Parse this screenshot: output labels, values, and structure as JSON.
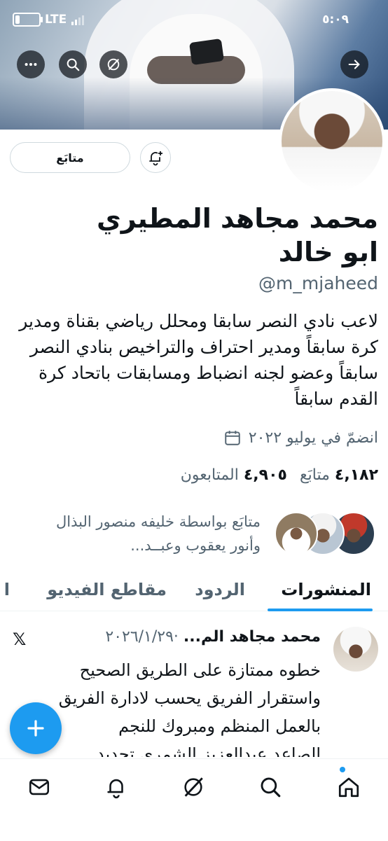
{
  "status_bar": {
    "network": "LTE",
    "time": "٥:٠٩"
  },
  "header_buttons": [
    "more-icon",
    "search-icon",
    "grok-icon",
    "forward-arrow-icon"
  ],
  "profile": {
    "follow_label": "متابَع",
    "name_line1": "محمد مجاهد المطيري",
    "name_line2": "ابو خالد",
    "handle": "@m_mjaheed",
    "bio": "لاعب نادي النصر سابقا ومحلل رياضي بقناة ومدير كرة سابقاً ومدير احتراف والتراخيص بنادي النصر سابقاً وعضو لجنه انضباط ومسابقات باتحاد كرة القدم سابقاً",
    "joined": "انضمّ في يوليو ٢٠٢٢",
    "following_count": "٤,١٨٢",
    "following_label": "متابَع",
    "followers_count": "٤,٩٠٥",
    "followers_label": "المتابعون",
    "followed_by": "متابَع بواسطة خليفه منصور البذال وأنور يعقوب وعبــد..."
  },
  "tabs": [
    {
      "label": "المنشورات",
      "active": true
    },
    {
      "label": "الردود",
      "active": false
    },
    {
      "label": "مقاطع الفيديو",
      "active": false
    },
    {
      "label": "ا",
      "active": false
    }
  ],
  "post": {
    "author": "محمد مجاهد الم...",
    "date": "٢٠٢٦/١/٢٩",
    "separator": "·",
    "source_icon": "x-logo",
    "lines": [
      "خطوه ممتازة على الطريق الصحيح",
      "واستقرار الفريق يحسب لادارة الفريق",
      "بالعمل المنظم ومبروك للنجم",
      "الصاعد عبدالعزيز الشمري تجديد"
    ]
  },
  "colors": {
    "accent": "#1d9bf0",
    "text": "#0f1419",
    "muted": "#536471"
  },
  "bottom_nav": [
    "home-icon",
    "search-icon",
    "grok-icon",
    "notifications-icon",
    "messages-icon"
  ]
}
